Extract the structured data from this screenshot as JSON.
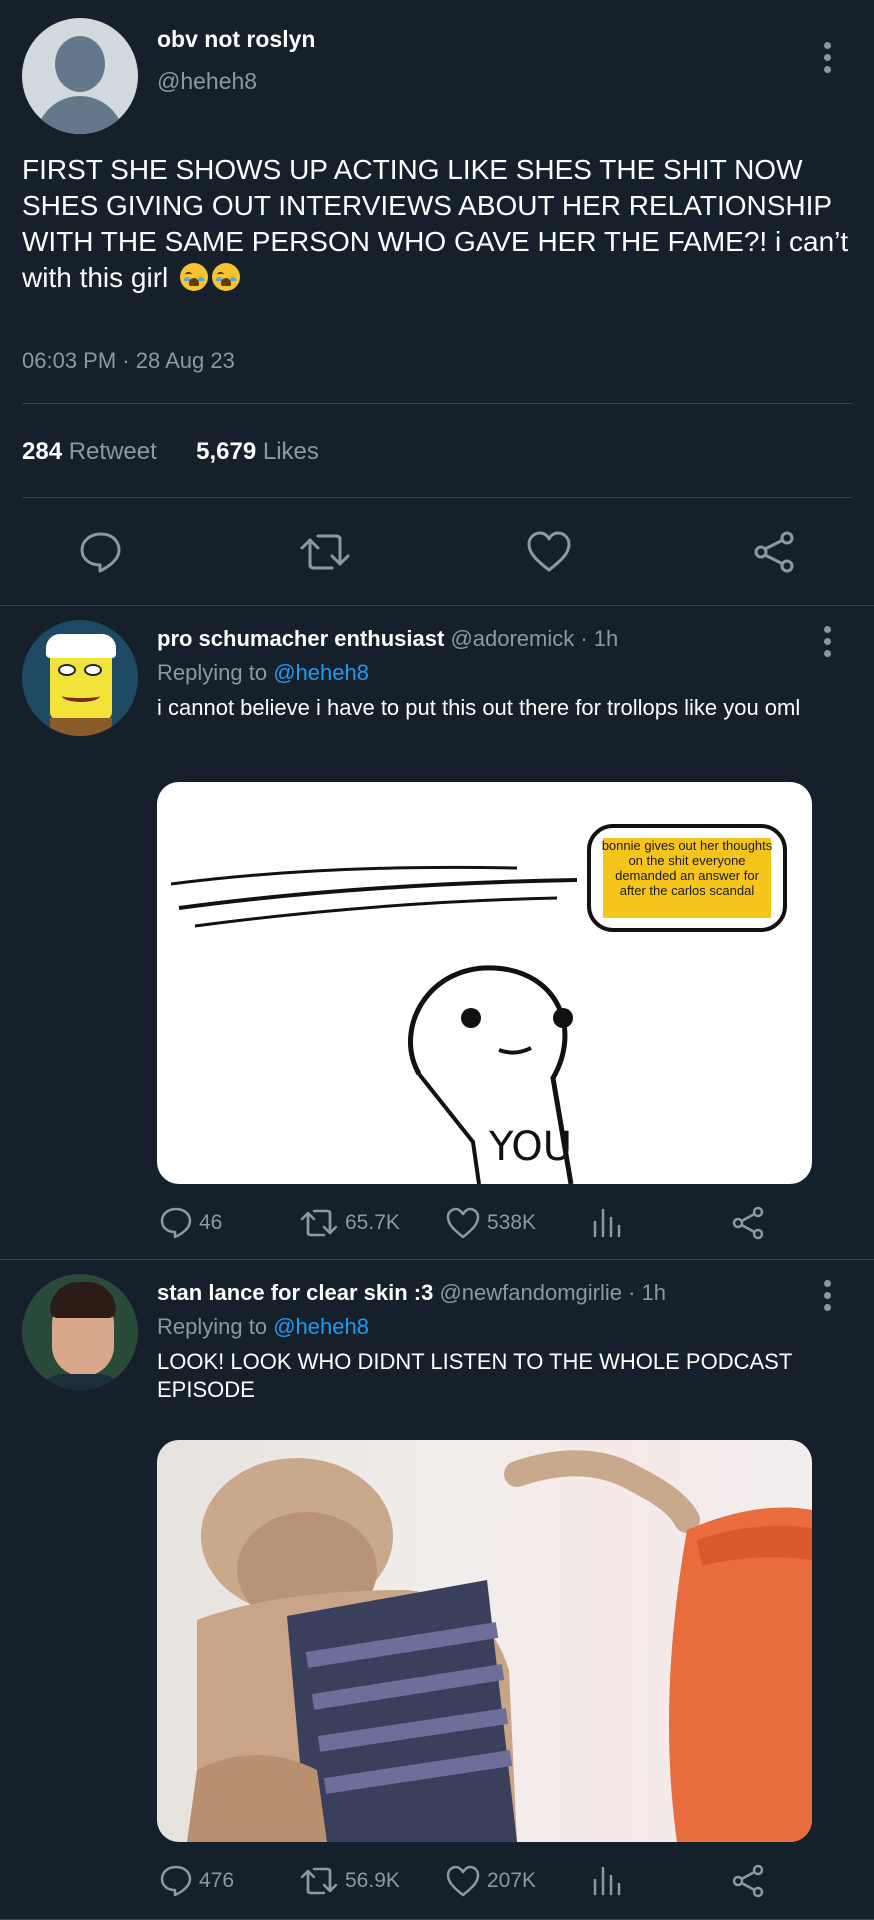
{
  "main_tweet": {
    "display_name": "obv not roslyn",
    "handle": "@heheh8",
    "text": "FIRST SHE SHOWS UP ACTING LIKE SHES THE SHIT NOW SHES GIVING OUT INTERVIEWS ABOUT HER RELATIONSHIP WITH THE SAME PERSON WHO GAVE HER THE FAME?! i can’t with this girl",
    "emojis": [
      "loudly-crying-face-emoji",
      "loudly-crying-face-emoji"
    ],
    "timestamp": "06:03 PM · 28 Aug 23",
    "retweet_count": "284",
    "retweet_label": "Retweet",
    "like_count": "5,679",
    "like_label": "Likes"
  },
  "replies": [
    {
      "display_name": "pro schumacher enthusiast",
      "handle_time": "@adoremick · 1h",
      "replying_prefix": "Replying to",
      "replying_handle": "@heheh8",
      "text": "i cannot believe i have to put this out there for trollops like you oml",
      "media": {
        "bubble_text": "bonnie gives out her thoughts on the shit everyone demanded an answer for after the carlos scandal",
        "label": "YOU"
      },
      "replies_count": "46",
      "retweets_count": "65.7K",
      "likes_count": "538K"
    },
    {
      "display_name": "stan lance for clear skin :3",
      "handle_time": "@newfandomgirlie · 1h",
      "replying_prefix": "Replying to",
      "replying_handle": "@heheh8",
      "text": "LOOK! LOOK WHO DIDNT LISTEN TO THE WHOLE PODCAST EPISODE",
      "replies_count": "476",
      "retweets_count": "56.9K",
      "likes_count": "207K"
    }
  ],
  "colors": {
    "background": "#15202b",
    "muted": "#8b98a5",
    "link": "#1d9bf0",
    "divider": "#38444d"
  }
}
